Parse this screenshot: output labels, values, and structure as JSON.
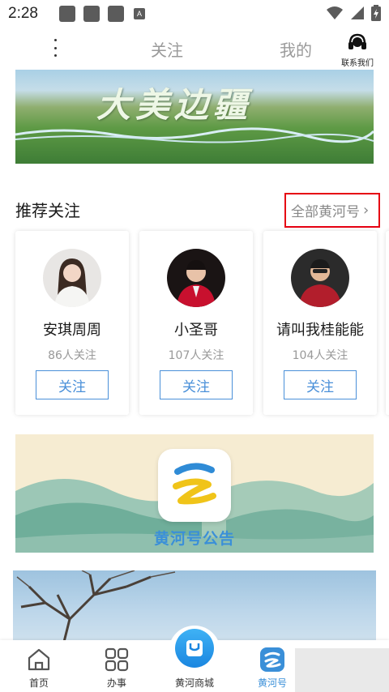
{
  "status_bar": {
    "time": "2:28",
    "notif_letter": "A"
  },
  "top_nav": {
    "tab_follow": "关注",
    "tab_mine": "我的",
    "contact_label": "联系我们"
  },
  "banner": {
    "title": "大美边疆"
  },
  "recommend": {
    "title": "推荐关注",
    "all_link": "全部黄河号",
    "cards": [
      {
        "name": "安琪周周",
        "fans": "86人关注",
        "button": "关注"
      },
      {
        "name": "小圣哥",
        "fans": "107人关注",
        "button": "关注"
      },
      {
        "name": "请叫我桂能能",
        "fans": "104人关注",
        "button": "关注"
      }
    ]
  },
  "notice": {
    "title": "黄河号公告"
  },
  "bottom_nav": {
    "items": [
      {
        "label": "首页"
      },
      {
        "label": "办事"
      },
      {
        "label": "黄河商城"
      },
      {
        "label": "黄河号"
      }
    ]
  },
  "colors": {
    "accent": "#3a8fd8",
    "highlight_box": "#e60012",
    "follow_border": "#4a90d9"
  }
}
